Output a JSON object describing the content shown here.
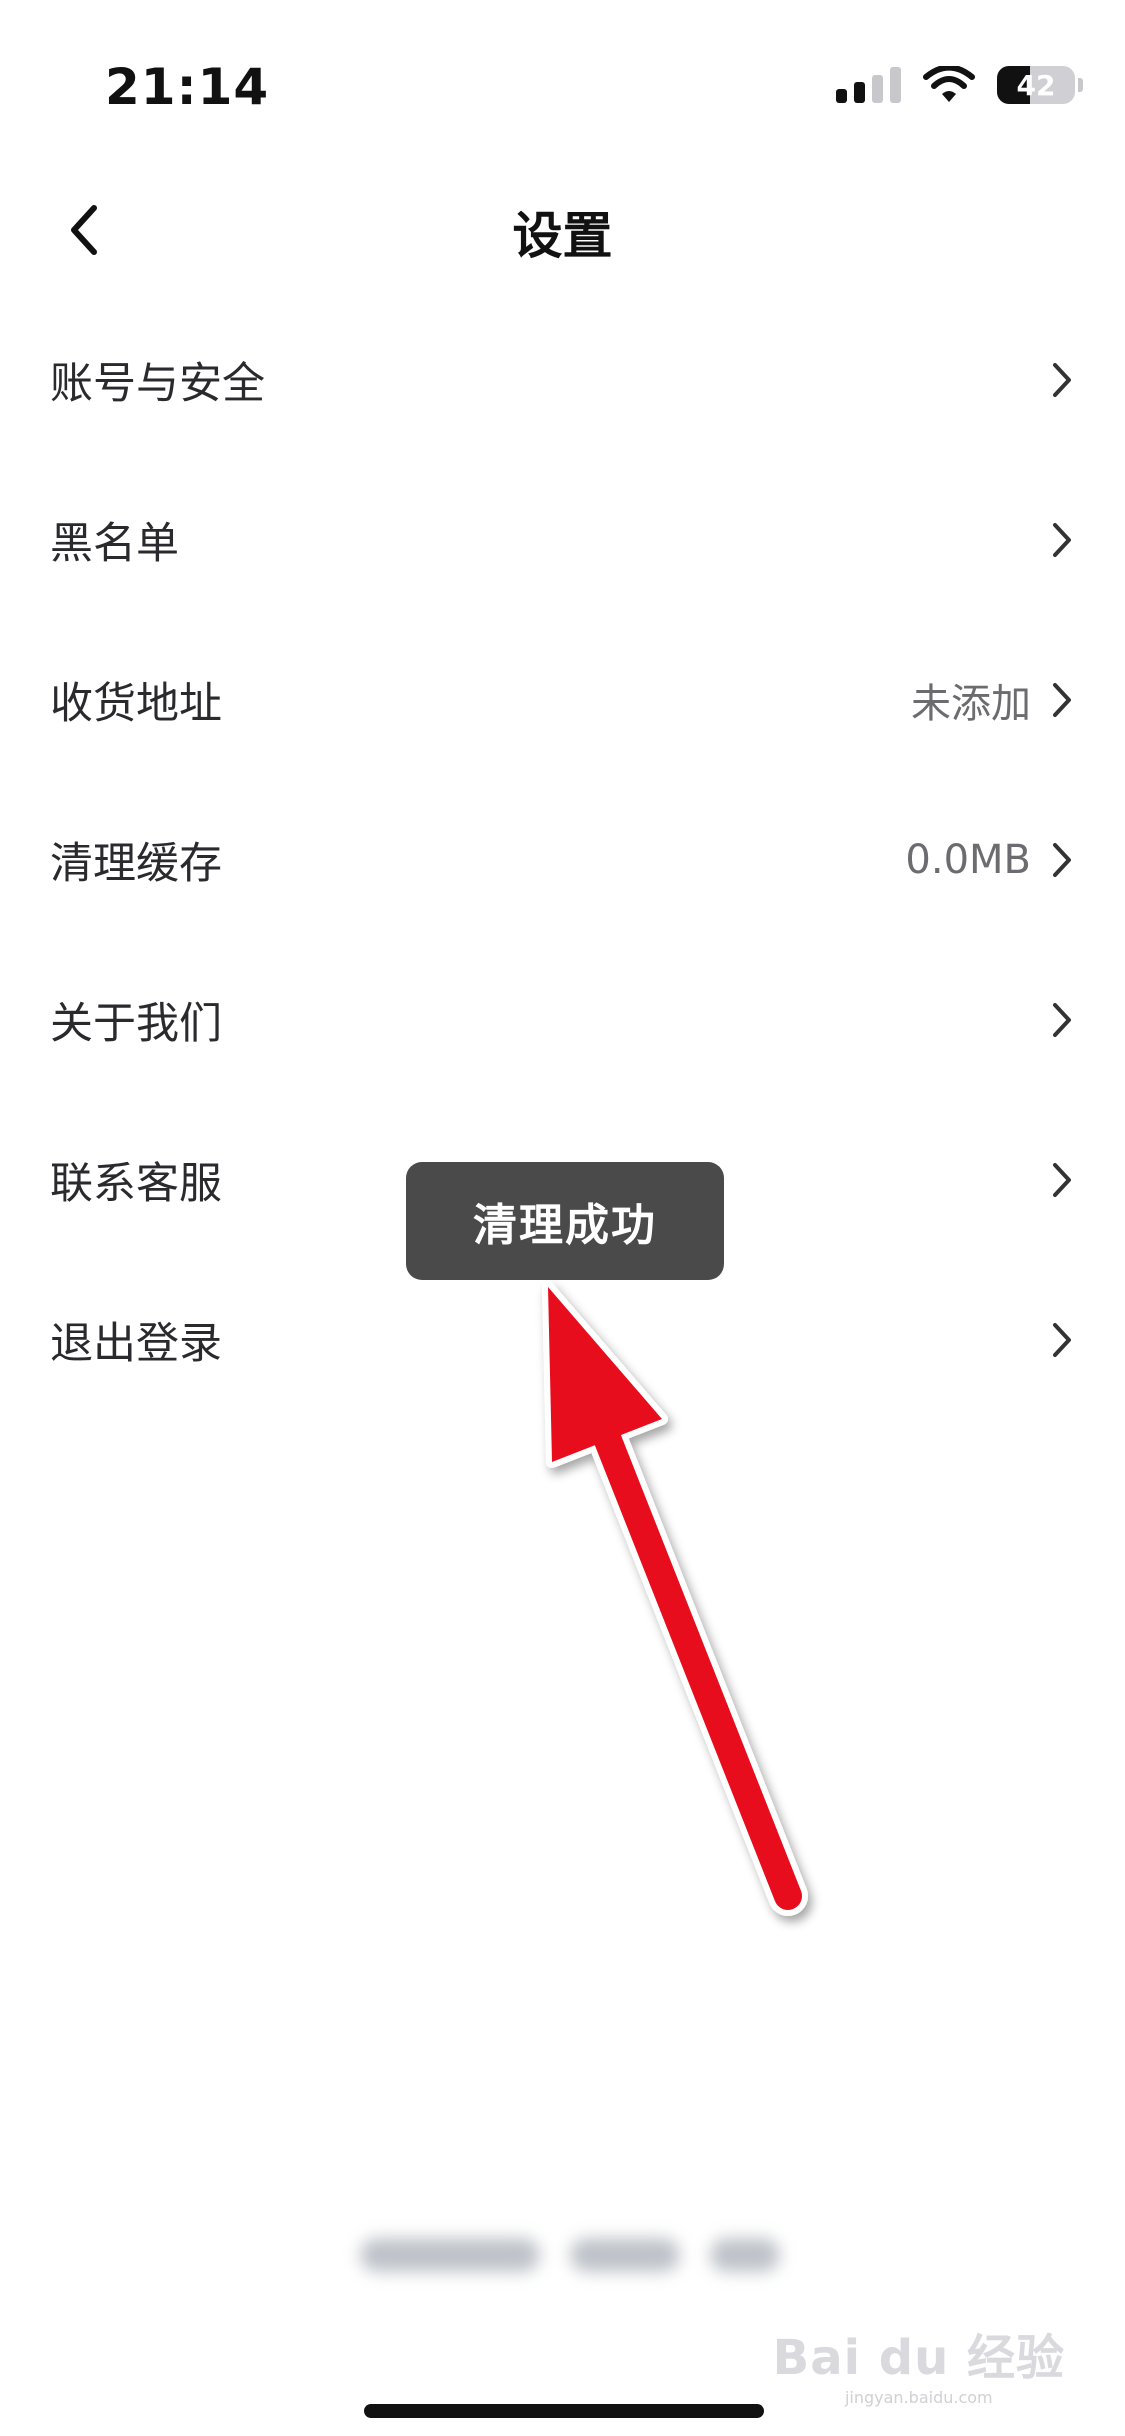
{
  "status_bar": {
    "time": "21:14",
    "battery_level": "42",
    "signal_bars": 2,
    "icons": [
      "signal-icon",
      "wifi-icon",
      "battery-icon"
    ]
  },
  "nav": {
    "title": "设置",
    "back_icon": "chevron-left-icon"
  },
  "settings": {
    "items": [
      {
        "label": "账号与安全",
        "value": ""
      },
      {
        "label": "黑名单",
        "value": ""
      },
      {
        "label": "收货地址",
        "value": "未添加"
      },
      {
        "label": "清理缓存",
        "value": "0.0MB"
      },
      {
        "label": "关于我们",
        "value": ""
      },
      {
        "label": "联系客服",
        "value": ""
      },
      {
        "label": "退出登录",
        "value": ""
      }
    ]
  },
  "toast": {
    "message": "清理成功"
  },
  "watermark": {
    "brand": "Bai du 经验",
    "url": "jingyan.baidu.com"
  },
  "colors": {
    "background": "#ffffff",
    "toast_bg": "#4a4a4a",
    "annotation_arrow": "#e8101e",
    "label_text": "#2a2a2e",
    "value_text": "#6b6b70"
  }
}
